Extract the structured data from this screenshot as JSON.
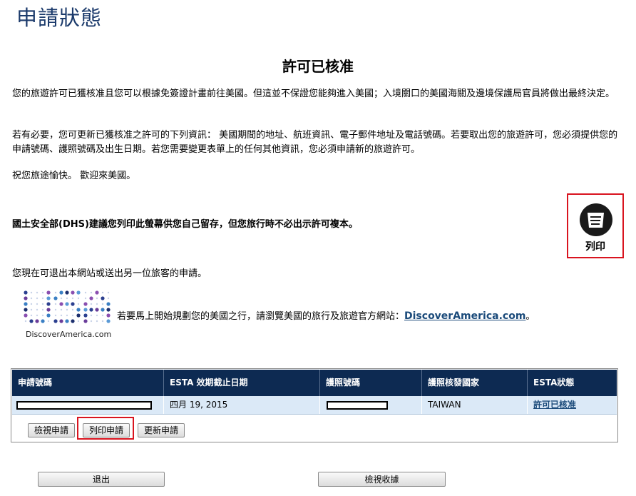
{
  "header": {
    "title": "申請狀態"
  },
  "content": {
    "heading": "許可已核准",
    "p1": "您的旅遊許可已獲核准且您可以根據免簽證計畫前往美國。但這並不保證您能夠進入美國；入境關口的美國海關及邊境保護局官員將做出最終決定。",
    "p2": "若有必要，您可更新已獲核准之許可的下列資訊： 美國期間的地址、航班資訊、電子郵件地址及電話號碼。若要取出您的旅遊許可，您必須提供您的申請號碼、護照號碼及出生日期。若您需要變更表單上的任何其他資訊，您必須申請新的旅遊許可。",
    "p3": "祝您旅途愉快。 歡迎來美國。",
    "p4": "國土安全部(DHS)建議您列印此螢幕供您自己留存，但您旅行時不必出示許可複本。",
    "p5": "您現在可退出本網站或送出另一位旅客的申請。",
    "discover_text": "若要馬上開始規劃您的美國之行，請瀏覽美國的旅行及旅遊官方網站：",
    "discover_link": "DiscoverAmerica.com",
    "discover_suffix": "。",
    "logo_caption": "DiscoverAmerica.com"
  },
  "print": {
    "label": "列印",
    "icon": "print-document-icon"
  },
  "table": {
    "headers": [
      "申請號碼",
      "ESTA 效期截止日期",
      "護照號碼",
      "護照核發國家",
      "ESTA狀態"
    ],
    "row": {
      "expiry": "四月 19, 2015",
      "country": "TAIWAN",
      "status": "許可已核准"
    },
    "buttons": {
      "view": "檢視申請",
      "print": "列印申請",
      "update": "更新申請"
    }
  },
  "footer": {
    "exit": "退出",
    "receipt": "檢視收據"
  },
  "colors": {
    "title": "#1b3a6b",
    "table_header": "#0d2a52",
    "row_bg": "#dbe9f7",
    "highlight": "#d9141f",
    "link": "#1a4a7a"
  }
}
